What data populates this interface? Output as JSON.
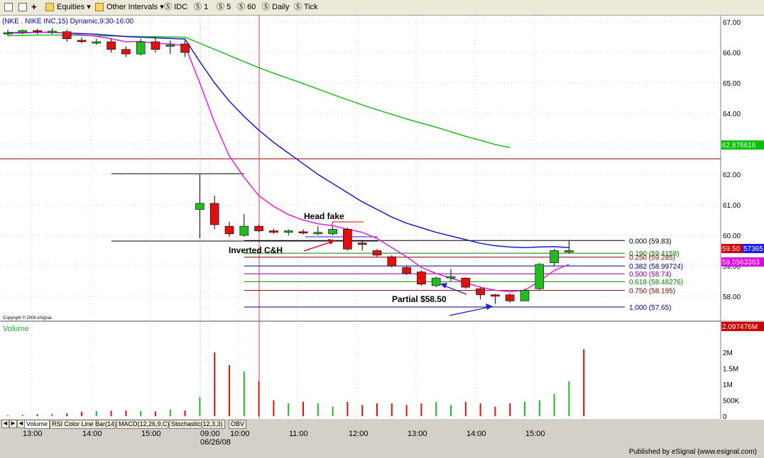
{
  "toolbar": {
    "equities_label": "Equities",
    "other_intervals_label": "Other Intervals",
    "intervals": [
      "IDC",
      "1",
      "5",
      "60",
      "Daily",
      "Tick"
    ]
  },
  "chart": {
    "title": "(NKE . NIKE INC,15) Dynamic,9:30-16:00",
    "copyright": "Copyright © 2006 eSignal.",
    "volume_label": "Volume",
    "date_label": "06/26/08",
    "credit": "Published by eSignal (www.esignal.com)",
    "right_tags": [
      {
        "text": "62.876616",
        "bg": "#00c000",
        "fg": "#ffffff"
      },
      {
        "text": "59.50",
        "bg": "#cc0000",
        "fg": "#ffffff"
      },
      {
        "text": "57365",
        "bg": "#1a1aff",
        "fg": "#ffffff"
      },
      {
        "text": "59.0563363",
        "bg": "#e000e0",
        "fg": "#ffffff"
      },
      {
        "text": "2.097476M",
        "bg": "#cc0000",
        "fg": "#ffffff"
      }
    ],
    "annotations": {
      "head_fake": "Head fake",
      "inverted": "Inverted C&H",
      "partial": "Partial $58.50"
    },
    "fib_labels": [
      {
        "text": "0.000 (59.83)",
        "color": "#000000"
      },
      {
        "text": "0.190 (59.4158)",
        "color": "#008000"
      },
      {
        "text": "0.250 (59.285)",
        "color": "#800000"
      },
      {
        "text": "0.382 (58.99724)",
        "color": "#000080"
      },
      {
        "text": "0.500 (58.74)",
        "color": "#800080"
      },
      {
        "text": "0.618 (58.48276)",
        "color": "#008000"
      },
      {
        "text": "0.750 (58.195)",
        "color": "#800000"
      },
      {
        "text": "1.000 (57.65)",
        "color": "#000080"
      }
    ]
  },
  "tabs": [
    "Volume",
    "RSI Color Line Bar(14)",
    "MACD(12,26,9,C)",
    "Stochastic(12,3,3)",
    "OBV"
  ],
  "colors": {
    "up": "#22bb22",
    "down": "#dd1111",
    "ma_fast": "#e020e0",
    "ma_mid": "#1a1acc",
    "ma_slow": "#22bb22"
  },
  "chart_data": {
    "type": "candlestick",
    "x_tick_labels": [
      "13:00",
      "14:00",
      "15:00",
      "09:00",
      "10:00",
      "11:00",
      "12:00",
      "13:00",
      "14:00",
      "15:00"
    ],
    "price_ticks": [
      "67.00",
      "66.00",
      "65.00",
      "64.00",
      "63.00",
      "62.00",
      "61.00",
      "60.00",
      "59.00",
      "58.00"
    ],
    "volume_ticks": [
      "2M",
      "1.5M",
      "1M",
      "500K",
      "0"
    ],
    "ylim": [
      57.3,
      67.3
    ],
    "candles": [
      {
        "o": 66.65,
        "h": 66.75,
        "l": 66.55,
        "c": 66.65
      },
      {
        "o": 66.65,
        "h": 66.75,
        "l": 66.6,
        "c": 66.72
      },
      {
        "o": 66.72,
        "h": 66.78,
        "l": 66.6,
        "c": 66.68
      },
      {
        "o": 66.7,
        "h": 66.8,
        "l": 66.6,
        "c": 66.7
      },
      {
        "o": 66.68,
        "h": 66.75,
        "l": 66.35,
        "c": 66.45
      },
      {
        "o": 66.4,
        "h": 66.5,
        "l": 66.3,
        "c": 66.38
      },
      {
        "o": 66.35,
        "h": 66.45,
        "l": 66.25,
        "c": 66.35
      },
      {
        "o": 66.35,
        "h": 66.45,
        "l": 66.0,
        "c": 66.1
      },
      {
        "o": 66.1,
        "h": 66.2,
        "l": 65.85,
        "c": 65.95
      },
      {
        "o": 65.95,
        "h": 66.45,
        "l": 65.9,
        "c": 66.35
      },
      {
        "o": 66.35,
        "h": 66.5,
        "l": 66.0,
        "c": 66.1
      },
      {
        "o": 66.2,
        "h": 66.4,
        "l": 65.95,
        "c": 66.25
      },
      {
        "o": 66.28,
        "h": 66.4,
        "l": 65.85,
        "c": 66.0
      },
      {
        "o": 60.85,
        "h": 62.0,
        "l": 59.9,
        "c": 61.05
      },
      {
        "o": 61.05,
        "h": 61.3,
        "l": 60.2,
        "c": 60.35
      },
      {
        "o": 60.3,
        "h": 60.45,
        "l": 59.95,
        "c": 60.05
      },
      {
        "o": 60.0,
        "h": 60.7,
        "l": 59.95,
        "c": 60.3
      },
      {
        "o": 60.3,
        "h": 60.35,
        "l": 60.1,
        "c": 60.15
      },
      {
        "o": 60.15,
        "h": 60.22,
        "l": 60.05,
        "c": 60.1
      },
      {
        "o": 60.1,
        "h": 60.2,
        "l": 60.0,
        "c": 60.15
      },
      {
        "o": 60.12,
        "h": 60.2,
        "l": 60.03,
        "c": 60.08
      },
      {
        "o": 60.05,
        "h": 60.3,
        "l": 60.0,
        "c": 60.1
      },
      {
        "o": 60.05,
        "h": 60.25,
        "l": 60.0,
        "c": 60.2
      },
      {
        "o": 60.2,
        "h": 60.25,
        "l": 59.5,
        "c": 59.55
      },
      {
        "o": 59.75,
        "h": 59.85,
        "l": 59.5,
        "c": 59.7
      },
      {
        "o": 59.5,
        "h": 59.55,
        "l": 59.3,
        "c": 59.35
      },
      {
        "o": 59.3,
        "h": 59.35,
        "l": 58.95,
        "c": 59.0
      },
      {
        "o": 58.95,
        "h": 59.0,
        "l": 58.7,
        "c": 58.75
      },
      {
        "o": 58.8,
        "h": 58.85,
        "l": 58.35,
        "c": 58.4
      },
      {
        "o": 58.35,
        "h": 58.65,
        "l": 58.3,
        "c": 58.6
      },
      {
        "o": 58.6,
        "h": 58.9,
        "l": 58.5,
        "c": 58.65
      },
      {
        "o": 58.6,
        "h": 58.62,
        "l": 58.25,
        "c": 58.3
      },
      {
        "o": 58.25,
        "h": 58.3,
        "l": 57.9,
        "c": 58.05
      },
      {
        "o": 58.05,
        "h": 58.08,
        "l": 57.75,
        "c": 58.02
      },
      {
        "o": 58.05,
        "h": 58.1,
        "l": 57.8,
        "c": 57.85
      },
      {
        "o": 57.85,
        "h": 58.25,
        "l": 57.85,
        "c": 58.2
      },
      {
        "o": 58.25,
        "h": 59.1,
        "l": 58.2,
        "c": 59.05
      },
      {
        "o": 59.1,
        "h": 59.55,
        "l": 59.0,
        "c": 59.5
      },
      {
        "o": 59.45,
        "h": 59.85,
        "l": 59.4,
        "c": 59.5
      }
    ],
    "volume_series": [
      0.03,
      0.05,
      0.06,
      0.08,
      0.09,
      0.14,
      0.16,
      0.17,
      0.18,
      0.16,
      0.15,
      0.21,
      0.18,
      0.6,
      2.0,
      1.6,
      1.4,
      1.1,
      0.5,
      0.4,
      0.45,
      0.4,
      0.3,
      0.45,
      0.35,
      0.4,
      0.4,
      0.35,
      0.4,
      0.45,
      0.35,
      0.45,
      0.4,
      0.3,
      0.4,
      0.45,
      0.5,
      0.7,
      1.1,
      2.1
    ],
    "ma_fast": [
      66.63,
      66.64,
      66.66,
      66.67,
      66.63,
      66.58,
      66.53,
      66.45,
      66.35,
      66.36,
      66.3,
      66.28,
      66.22,
      65.0,
      63.7,
      62.6,
      61.9,
      61.3,
      60.95,
      60.68,
      60.5,
      60.38,
      60.32,
      60.2,
      60.1,
      59.9,
      59.6,
      59.3,
      58.95,
      58.75,
      58.6,
      58.45,
      58.3,
      58.2,
      58.15,
      58.2,
      58.5,
      58.85,
      59.05
    ],
    "ma_mid": [
      66.65,
      66.65,
      66.66,
      66.66,
      66.64,
      66.62,
      66.6,
      66.56,
      66.52,
      66.5,
      66.48,
      66.46,
      66.44,
      65.7,
      65.0,
      64.4,
      63.9,
      63.45,
      63.05,
      62.7,
      62.35,
      62.0,
      61.7,
      61.4,
      61.1,
      60.85,
      60.6,
      60.4,
      60.25,
      60.1,
      59.98,
      59.86,
      59.74,
      59.66,
      59.62,
      59.6,
      59.62,
      59.63,
      59.6
    ],
    "ma_slow": [
      66.55,
      66.56,
      66.57,
      66.57,
      66.57,
      66.56,
      66.55,
      66.54,
      66.53,
      66.52,
      66.52,
      66.51,
      66.5,
      66.3,
      66.1,
      65.9,
      65.7,
      65.5,
      65.32,
      65.15,
      64.98,
      64.8,
      64.62,
      64.45,
      64.28,
      64.12,
      63.97,
      63.82,
      63.68,
      63.55,
      63.4,
      63.25,
      63.12,
      62.98,
      62.88
    ],
    "fib_levels": [
      59.83,
      59.4158,
      59.285,
      58.99724,
      58.74,
      58.48276,
      58.195,
      57.65
    ]
  }
}
